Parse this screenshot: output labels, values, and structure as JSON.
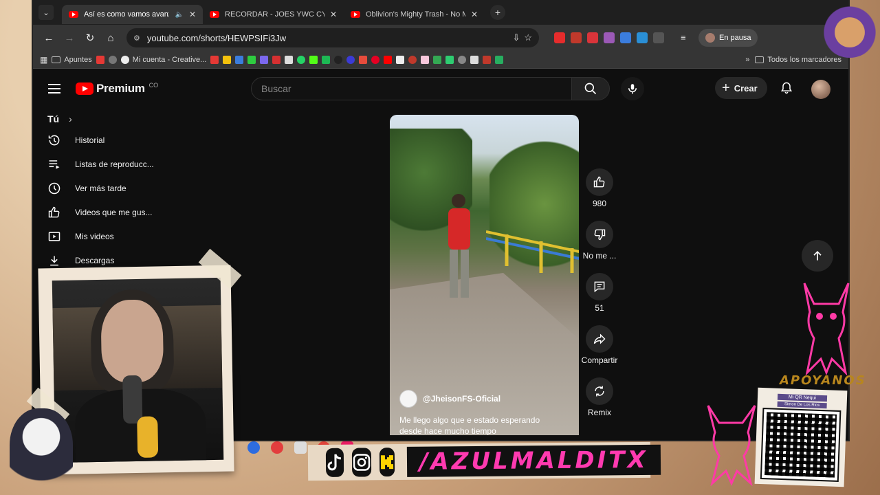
{
  "browser": {
    "tabs": [
      {
        "title": "Así es como vamos avanzan",
        "active": true
      },
      {
        "title": "RECORDAR - JOES YWC CYPHE",
        "active": false
      },
      {
        "title": "Oblivion's Mighty Trash - No M",
        "active": false
      }
    ],
    "url": "youtube.com/shorts/HEWPSIFi3Jw",
    "profile_label": "En pausa",
    "bookmarks": {
      "apuntes": "Apuntes",
      "mi_cuenta": "Mi cuenta - Creative...",
      "todos": "Todos los marcadores",
      "more": "»"
    }
  },
  "youtube": {
    "logo_text": "Premium",
    "logo_suffix": "CO",
    "search_placeholder": "Buscar",
    "create_label": "Crear",
    "sidebar": {
      "section": "Tú",
      "items": [
        {
          "label": "Historial",
          "icon": "history-icon"
        },
        {
          "label": "Listas de reproducc...",
          "icon": "playlist-icon"
        },
        {
          "label": "Ver más tarde",
          "icon": "watch-later-icon"
        },
        {
          "label": "Videos que me gus...",
          "icon": "like-icon"
        },
        {
          "label": "Mis videos",
          "icon": "my-videos-icon"
        },
        {
          "label": "Descargas",
          "icon": "download-icon"
        }
      ]
    },
    "short": {
      "channel": "@JheisonFS-Oficial",
      "description": "Me llego algo que e estado esperando desde hace mucho tiempo",
      "likes": "980",
      "dislike_label": "No me ...",
      "comments": "51",
      "share_label": "Compartir",
      "remix_label": "Remix"
    }
  },
  "overlay": {
    "handle": "/AZULMALDITX",
    "support_title": "APOYANOS",
    "qr_title": "Mi QR Nequi",
    "qr_name": "Simon De Los Rios"
  },
  "colors": {
    "accent_red": "#ff0000",
    "overlay_pink": "#ff3ab0",
    "gold": "#b8861d"
  }
}
